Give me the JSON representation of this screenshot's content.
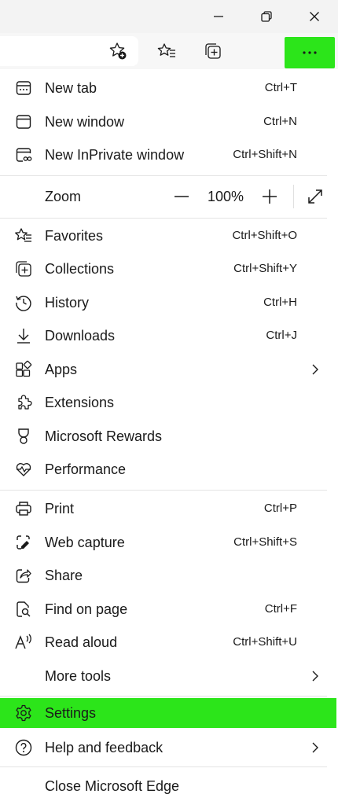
{
  "window": {
    "minimize_icon": "minimize-icon",
    "restore_icon": "restore-icon",
    "close_icon": "close-icon"
  },
  "toolbar": {
    "icons": [
      "add-favorite-icon",
      "favorites-icon",
      "collections-icon",
      "more-dots-icon"
    ],
    "highlight_color": "#2ce51a"
  },
  "menu": {
    "new_tab": {
      "label": "New tab",
      "shortcut": "Ctrl+T"
    },
    "new_window": {
      "label": "New window",
      "shortcut": "Ctrl+N"
    },
    "new_inprivate": {
      "label": "New InPrivate window",
      "shortcut": "Ctrl+Shift+N"
    },
    "zoom": {
      "label": "Zoom",
      "value": "100%",
      "minus": "—",
      "plus": "+"
    },
    "favorites": {
      "label": "Favorites",
      "shortcut": "Ctrl+Shift+O"
    },
    "collections": {
      "label": "Collections",
      "shortcut": "Ctrl+Shift+Y"
    },
    "history": {
      "label": "History",
      "shortcut": "Ctrl+H"
    },
    "downloads": {
      "label": "Downloads",
      "shortcut": "Ctrl+J"
    },
    "apps": {
      "label": "Apps"
    },
    "extensions": {
      "label": "Extensions"
    },
    "rewards": {
      "label": "Microsoft Rewards"
    },
    "performance": {
      "label": "Performance"
    },
    "print": {
      "label": "Print",
      "shortcut": "Ctrl+P"
    },
    "web_capture": {
      "label": "Web capture",
      "shortcut": "Ctrl+Shift+S"
    },
    "share": {
      "label": "Share"
    },
    "find": {
      "label": "Find on page",
      "shortcut": "Ctrl+F"
    },
    "read_aloud": {
      "label": "Read aloud",
      "shortcut": "Ctrl+Shift+U"
    },
    "more_tools": {
      "label": "More tools"
    },
    "settings": {
      "label": "Settings",
      "highlighted": true
    },
    "help": {
      "label": "Help and feedback"
    },
    "close_edge": {
      "label": "Close Microsoft Edge"
    }
  }
}
